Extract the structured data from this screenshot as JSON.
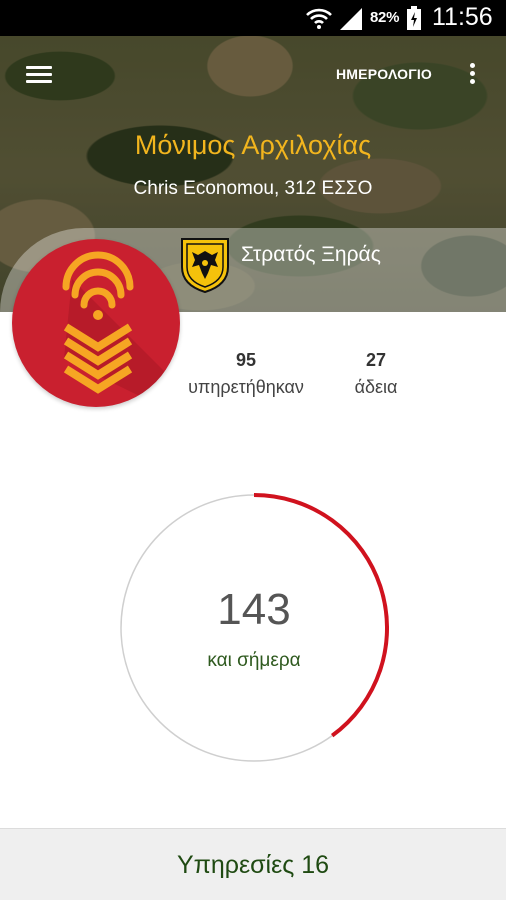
{
  "status_bar": {
    "battery_percent": "82%",
    "time": "11:56",
    "icons": [
      "wifi-icon",
      "signal-icon",
      "battery-icon"
    ]
  },
  "header": {
    "menu_icon": "hamburger-menu-icon",
    "calendar_label": "ΗΜΕΡΟΛΟΓΙΟ",
    "overflow_icon": "more-vert-icon",
    "rank": "Μόνιμος Αρχιλοχίας",
    "user": "Chris Economou, 312 ΕΣΣΟ",
    "branch": "Στρατός Ξηράς",
    "branch_emblem": "army-emblem-icon",
    "badge_icon": "chevron-rank-icon"
  },
  "stats": {
    "served": {
      "value": "95",
      "label": "υπηρετήθηκαν"
    },
    "leave": {
      "value": "27",
      "label": "άδεια"
    }
  },
  "progress": {
    "days": "143",
    "caption": "και σήμερα",
    "fraction": 0.4
  },
  "footer": {
    "services_label": "Υπηρεσίες 16"
  },
  "colors": {
    "accent_red": "#d0121e",
    "rank_gold": "#f2b51e",
    "badge_red": "#c9202f",
    "caption_green": "#2f5a1f"
  }
}
